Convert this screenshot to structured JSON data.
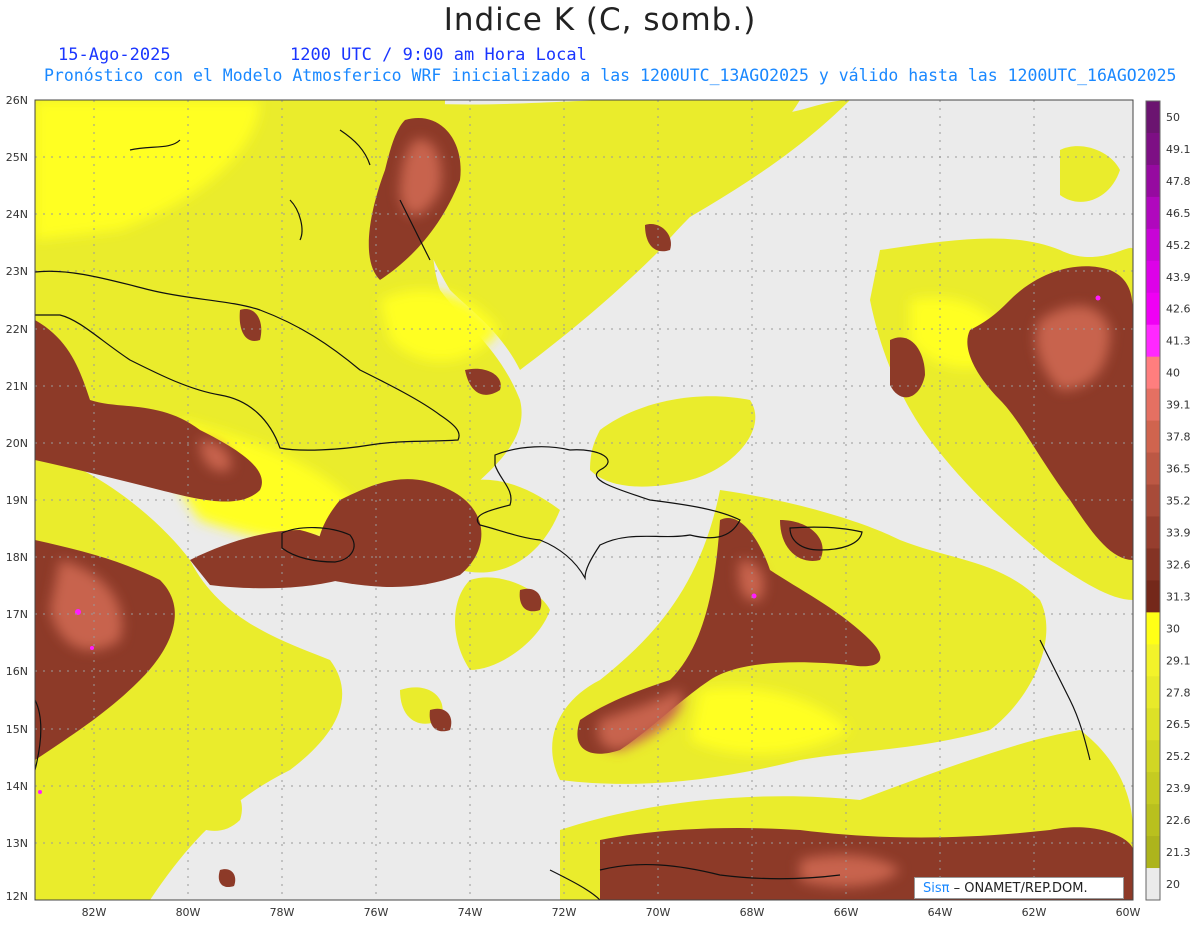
{
  "title": "Indice K (C, somb.)",
  "subtitle_date": "15-Ago-2025",
  "subtitle_time": "1200 UTC / 9:00 am Hora Local",
  "subtitle_model": "Pronóstico con el Modelo Atmosferico WRF inicializado a las 1200UTC_13AGO2025 y válido hasta las  1200UTC_16AGO2025",
  "credit": {
    "brand": "Sisπ",
    "org": " – ONAMET/REP.DOM."
  },
  "axes": {
    "lat_labels": [
      "26N",
      "25N",
      "24N",
      "23N",
      "22N",
      "21N",
      "20N",
      "19N",
      "18N",
      "17N",
      "16N",
      "15N",
      "14N",
      "13N",
      "12N"
    ],
    "lon_labels": [
      "82W",
      "80W",
      "78W",
      "76W",
      "74W",
      "72W",
      "70W",
      "68W",
      "66W",
      "64W",
      "62W",
      "60W"
    ]
  },
  "colorbar": {
    "labels": [
      "50",
      "49.1",
      "47.8",
      "46.5",
      "45.2",
      "43.9",
      "42.6",
      "41.3",
      "40",
      "39.1",
      "37.8",
      "36.5",
      "35.2",
      "33.9",
      "32.6",
      "31.3",
      "30",
      "29.1",
      "27.8",
      "26.5",
      "25.2",
      "23.9",
      "22.6",
      "21.3",
      "20"
    ],
    "colors": [
      "#6b1470",
      "#7d0f84",
      "#960aa0",
      "#b008bd",
      "#c805d6",
      "#dd02e8",
      "#ef00f4",
      "#ff28ff",
      "#ff7e7e",
      "#e57062",
      "#d0644e",
      "#bc5844",
      "#a84b39",
      "#963e2e",
      "#843324",
      "#74281a",
      "#ffff16",
      "#f3f32a",
      "#e8ea2a",
      "#dde127",
      "#d1d624",
      "#c5cb21",
      "#b9c01e",
      "#adb41c",
      "#ebebeb"
    ]
  },
  "colors": {
    "background": "#ebebeb",
    "land_outline": "#111111",
    "grid": "#9a9a9a"
  }
}
